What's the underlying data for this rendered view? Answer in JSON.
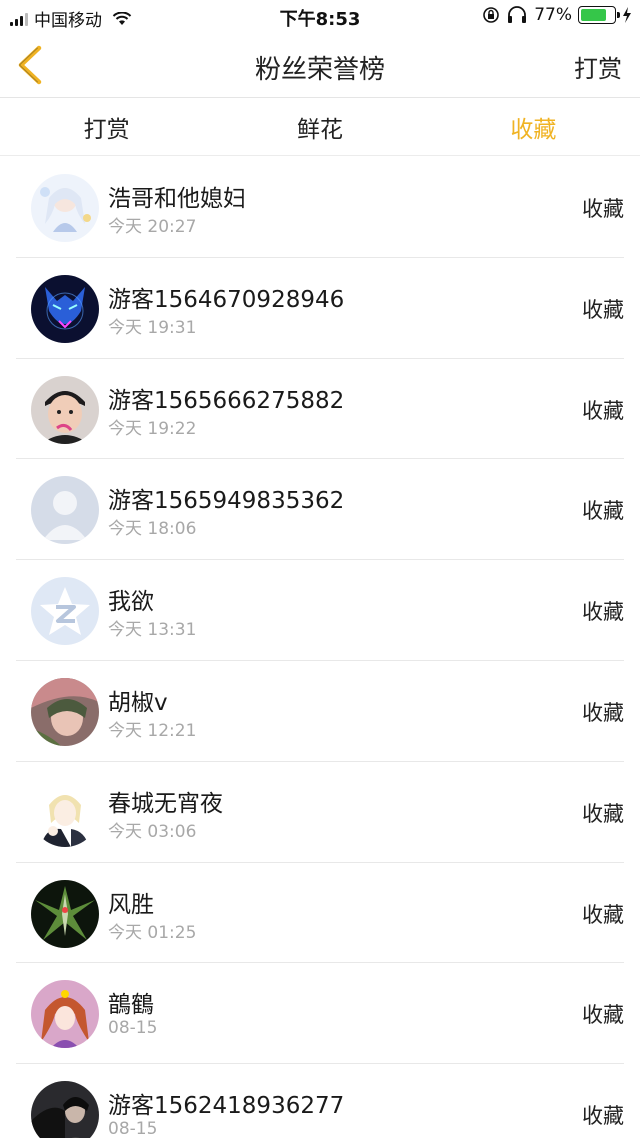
{
  "status_bar": {
    "carrier": "中国移动",
    "time": "下午8:53",
    "battery_percent": "77%",
    "battery_level": 0.77
  },
  "nav": {
    "title": "粉丝荣誉榜",
    "right_label": "打赏",
    "back_icon": "chevron-left-icon",
    "accent_color": "#f0b323"
  },
  "tabs": [
    {
      "label": "打赏",
      "active": false
    },
    {
      "label": "鲜花",
      "active": false
    },
    {
      "label": "收藏",
      "active": true
    }
  ],
  "list": [
    {
      "name": "浩哥和他媳妇",
      "time": "今天 20:27",
      "action": "收藏",
      "avatar": "anime-girl-avatar"
    },
    {
      "name": "游客1564670928946",
      "time": "今天 19:31",
      "action": "收藏",
      "avatar": "blue-wolf-avatar"
    },
    {
      "name": "游客1565666275882",
      "time": "今天 19:22",
      "action": "收藏",
      "avatar": "boy-photo-avatar"
    },
    {
      "name": "游客1565949835362",
      "time": "今天 18:06",
      "action": "收藏",
      "avatar": "default-person-avatar"
    },
    {
      "name": "我欲",
      "time": "今天 13:31",
      "action": "收藏",
      "avatar": "qq-star-avatar"
    },
    {
      "name": "胡椒v",
      "time": "今天 12:21",
      "action": "收藏",
      "avatar": "pink-anime-avatar"
    },
    {
      "name": "春城无宵夜",
      "time": "今天 03:06",
      "action": "收藏",
      "avatar": "blonde-anime-avatar"
    },
    {
      "name": "风胜",
      "time": "今天 01:25",
      "action": "收藏",
      "avatar": "gundam-avatar"
    },
    {
      "name": "鶕鶴",
      "time": "08-15",
      "action": "收藏",
      "avatar": "purple-anime-avatar"
    },
    {
      "name": "游客1562418936277",
      "time": "08-15",
      "action": "收藏",
      "avatar": "dark-photo-avatar"
    }
  ]
}
